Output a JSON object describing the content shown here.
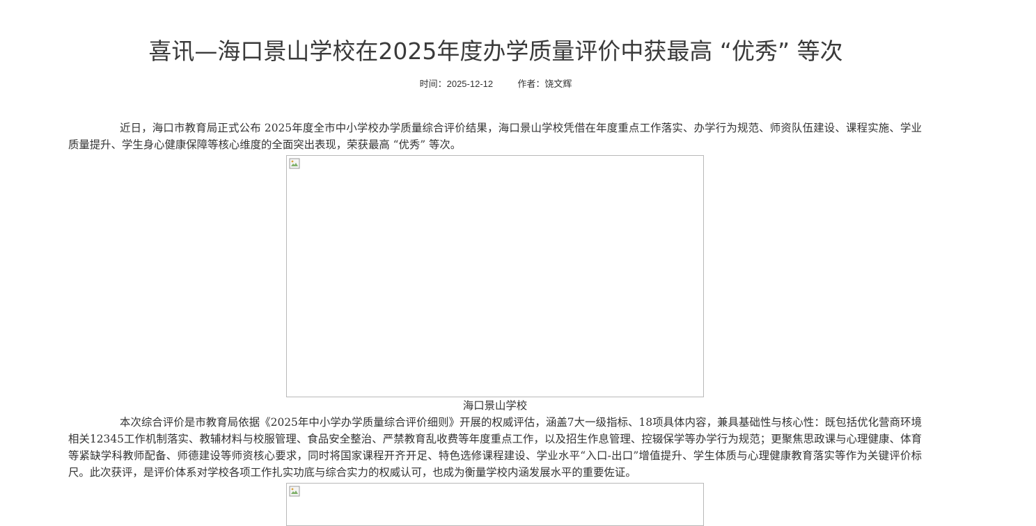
{
  "article": {
    "title": "喜讯—海口景山学校在2025年度办学质量评价中获最高 “优秀” 等次",
    "meta": {
      "date_label": "时间：",
      "date": "2025-12-12",
      "author_label": "作者：",
      "author": "饶文辉"
    },
    "paragraphs": [
      "近日，海口市教育局正式公布 2025年度全市中小学校办学质量综合评价结果，海口景山学校凭借在年度重点工作落实、办学行为规范、师资队伍建设、课程实施、学业质量提升、学生身心健康保障等核心维度的全面突出表现，荣获最高 “优秀” 等次。",
      "本次综合评价是市教育局依据《2025年中小学办学质量综合评价细则》开展的权威评估，涵盖7大一级指标、18项具体内容，兼具基础性与核心性：既包括优化营商环境相关12345工作机制落实、教辅材料与校服管理、食品安全整治、严禁教育乱收费等年度重点工作，以及招生作息管理、控辍保学等办学行为规范；更聚焦思政课与心理健康、体育等紧缺学科教师配备、师德建设等师资核心要求，同时将国家课程开齐开足、特色选修课程建设、学业水平“入口-出口”增值提升、学生体质与心理健康教育落实等作为关键评价标尺。此次获评，是评价体系对学校各项工作扎实功底与综合实力的权威认可，也成为衡量学校内涵发展水平的重要佐证。"
    ],
    "figures": [
      {
        "caption": "海口景山学校",
        "icon": "broken-image-icon"
      },
      {
        "caption": "",
        "icon": "broken-image-icon"
      }
    ]
  }
}
